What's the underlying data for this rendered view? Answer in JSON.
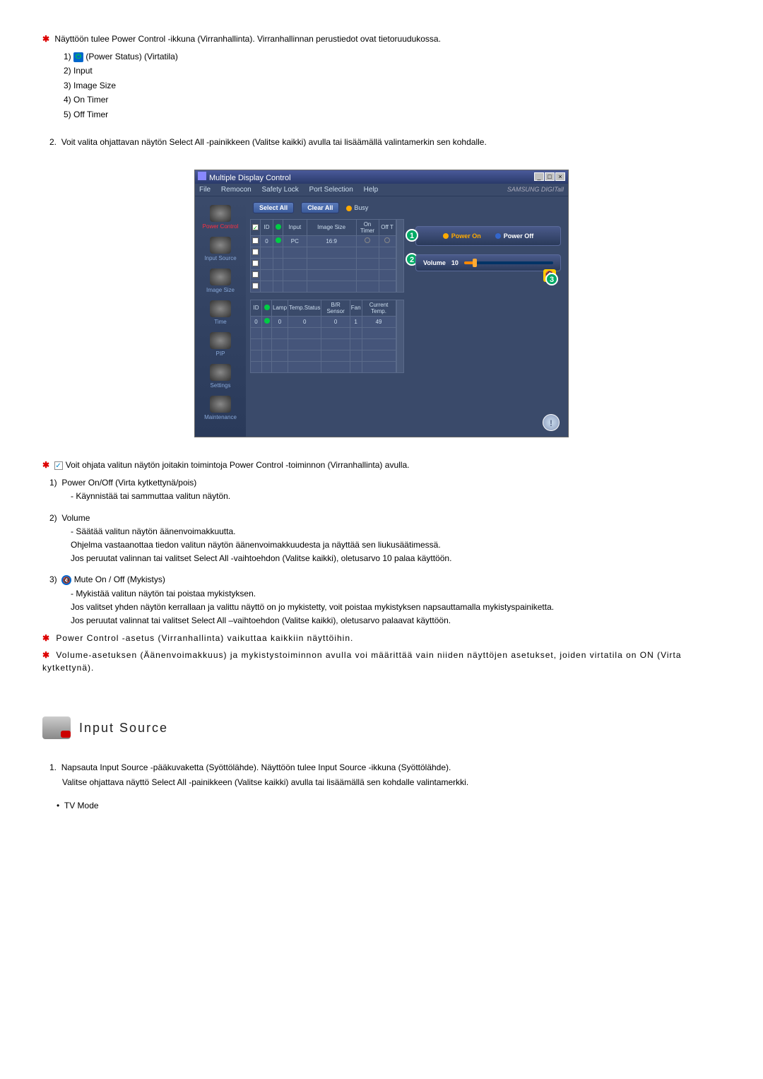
{
  "intro": {
    "star_line": "Näyttöön tulee Power Control -ikkuna (Virranhallinta). Virranhallinnan perustiedot ovat tietoruudukossa.",
    "items": [
      "(Power Status) (Virtatila)",
      "Input",
      "Image Size",
      "On Timer",
      "Off Timer"
    ],
    "numbered_2": "Voit valita ohjattavan näytön Select All -painikkeen (Valitse kaikki) avulla tai lisäämällä valintamerkin sen kohdalle."
  },
  "app": {
    "title": "Multiple Display Control",
    "menus": [
      "File",
      "Remocon",
      "Safety Lock",
      "Port Selection",
      "Help"
    ],
    "brand": "SAMSUNG DIGITall",
    "sidebar": [
      {
        "label": "Power Control",
        "active": true
      },
      {
        "label": "Input Source",
        "active": false
      },
      {
        "label": "Image Size",
        "active": false
      },
      {
        "label": "Time",
        "active": false
      },
      {
        "label": "PIP",
        "active": false
      },
      {
        "label": "Settings",
        "active": false
      },
      {
        "label": "Maintenance",
        "active": false
      }
    ],
    "select_all": "Select All",
    "clear_all": "Clear All",
    "busy": "Busy",
    "table1": {
      "headers": [
        "",
        "ID",
        "",
        "Input",
        "Image Size",
        "On Timer",
        "Off T"
      ],
      "row": [
        "",
        "0",
        "",
        "PC",
        "16:9",
        "",
        ""
      ]
    },
    "table2": {
      "headers": [
        "ID",
        "",
        "Lamp",
        "Temp.Status",
        "B/R Sensor",
        "Fan",
        "Current Temp."
      ],
      "row": [
        "0",
        "",
        "0",
        "0",
        "0",
        "1",
        "49"
      ]
    },
    "power_on": "Power On",
    "power_off": "Power Off",
    "volume_label": "Volume",
    "volume_value": "10"
  },
  "below": {
    "star_line": "Voit ohjata valitun näytön joitakin toimintoja Power Control -toiminnon (Virranhallinta) avulla.",
    "item1_title": "Power On/Off (Virta kytkettynä/pois)",
    "item1_sub": "- Käynnistää tai sammuttaa valitun näytön.",
    "item2_title": "Volume",
    "item2_sub1": "- Säätää valitun näytön äänenvoimakkuutta.",
    "item2_sub2": "Ohjelma vastaanottaa tiedon valitun näytön äänenvoimakkuudesta ja näyttää sen liukusäätimessä.",
    "item2_sub3": "Jos peruutat valinnan tai valitset Select All -vaihtoehdon (Valitse kaikki), oletusarvo 10 palaa käyttöön.",
    "item3_title": "Mute On / Off (Mykistys)",
    "item3_sub1": "- Mykistää valitun näytön tai poistaa mykistyksen.",
    "item3_sub2": "Jos valitset yhden näytön kerrallaan ja valittu näyttö on jo mykistetty, voit poistaa mykistyksen napsauttamalla mykistyspainiketta.",
    "item3_sub3": "Jos peruutat valinnat tai valitset Select All –vaihtoehdon (Valitse kaikki), oletusarvo palaavat käyttöön.",
    "note1": "Power Control -asetus (Virranhallinta) vaikuttaa kaikkiin näyttöihin.",
    "note2": "Volume-asetuksen (Äänenvoimakkuus) ja mykistystoiminnon avulla voi määrittää vain niiden näyttöjen asetukset, joiden virtatila on ON (Virta kytkettynä)."
  },
  "heading": "Input Source",
  "bottom": {
    "line1": "Napsauta Input Source -pääkuvaketta (Syöttölähde). Näyttöön tulee Input Source -ikkuna (Syöttölähde).",
    "line2": "Valitse ohjattava näyttö Select All -painikkeen (Valitse kaikki) avulla tai lisäämällä sen kohdalle valintamerkki.",
    "bullet": "TV Mode"
  }
}
